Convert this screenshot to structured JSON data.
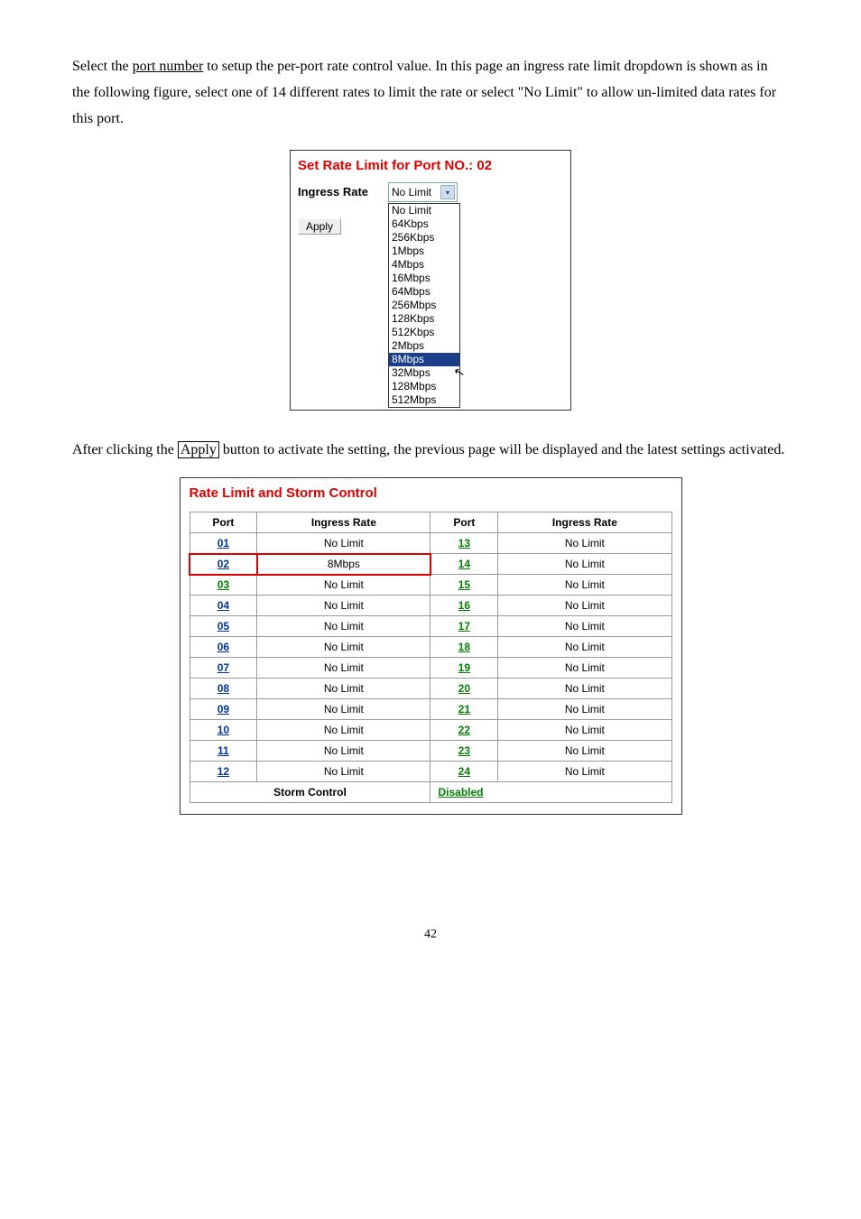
{
  "para1_parts": {
    "p1": "Select the ",
    "p2": "port number",
    "p3": " to setup the per-port rate control value. In this page an ingress rate limit dropdown is shown as in the following figure, select one of 14 different rates to limit the rate or select \"No Limit\" to allow un-limited data rates for this port."
  },
  "fig1": {
    "title": "Set Rate Limit for Port NO.: 02",
    "label": "Ingress Rate",
    "selected_display": "No Limit",
    "apply_label": "Apply",
    "options": [
      "No Limit",
      "64Kbps",
      "256Kbps",
      "1Mbps",
      "4Mbps",
      "16Mbps",
      "64Mbps",
      "256Mbps",
      "128Kbps",
      "512Kbps",
      "2Mbps",
      "8Mbps",
      "32Mbps",
      "128Mbps",
      "512Mbps"
    ],
    "highlighted_index": 11
  },
  "para2_parts": {
    "p1": "After clicking the ",
    "p2": "Apply",
    "p3": " button to activate the setting, the previous page will be displayed and the latest settings activated."
  },
  "fig2": {
    "title": "Rate Limit and Storm Control",
    "headers": {
      "port": "Port",
      "rate": "Ingress Rate"
    },
    "rows_left": [
      {
        "port": "01",
        "rate": "No Limit",
        "hl": false
      },
      {
        "port": "02",
        "rate": "8Mbps",
        "hl": true
      },
      {
        "port": "03",
        "rate": "No Limit",
        "hl": false,
        "green": true
      },
      {
        "port": "04",
        "rate": "No Limit",
        "hl": false
      },
      {
        "port": "05",
        "rate": "No Limit",
        "hl": false
      },
      {
        "port": "06",
        "rate": "No Limit",
        "hl": false
      },
      {
        "port": "07",
        "rate": "No Limit",
        "hl": false
      },
      {
        "port": "08",
        "rate": "No Limit",
        "hl": false
      },
      {
        "port": "09",
        "rate": "No Limit",
        "hl": false
      },
      {
        "port": "10",
        "rate": "No Limit",
        "hl": false
      },
      {
        "port": "11",
        "rate": "No Limit",
        "hl": false
      },
      {
        "port": "12",
        "rate": "No Limit",
        "hl": false
      }
    ],
    "rows_right": [
      {
        "port": "13",
        "rate": "No Limit"
      },
      {
        "port": "14",
        "rate": "No Limit"
      },
      {
        "port": "15",
        "rate": "No Limit"
      },
      {
        "port": "16",
        "rate": "No Limit"
      },
      {
        "port": "17",
        "rate": "No Limit"
      },
      {
        "port": "18",
        "rate": "No Limit"
      },
      {
        "port": "19",
        "rate": "No Limit"
      },
      {
        "port": "20",
        "rate": "No Limit"
      },
      {
        "port": "21",
        "rate": "No Limit"
      },
      {
        "port": "22",
        "rate": "No Limit"
      },
      {
        "port": "23",
        "rate": "No Limit"
      },
      {
        "port": "24",
        "rate": "No Limit"
      }
    ],
    "storm_label": "Storm Control",
    "storm_value": "Disabled"
  },
  "page_number": "42"
}
